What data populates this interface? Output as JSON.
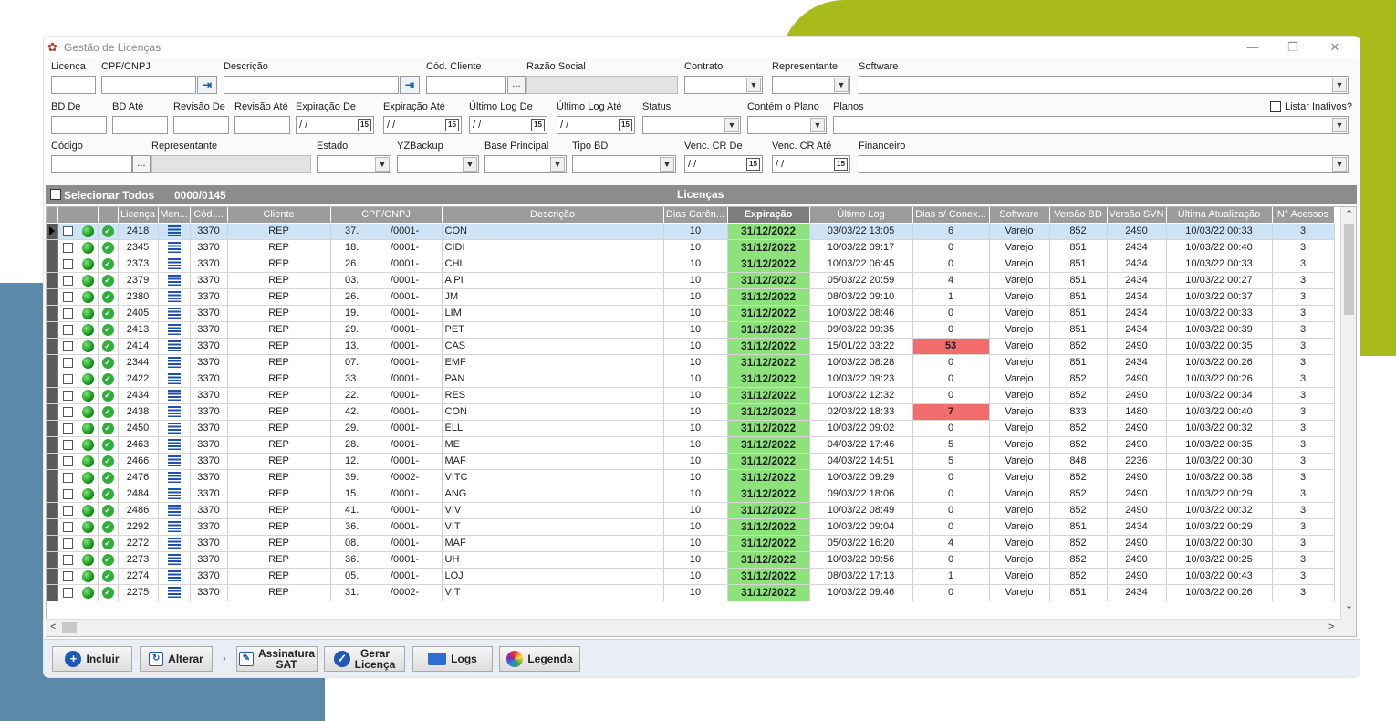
{
  "window": {
    "title": "Gestão de Licenças"
  },
  "filters": {
    "licenca": {
      "label": "Licença",
      "value": ""
    },
    "cpf_cnpj": {
      "label": "CPF/CNPJ",
      "value": ""
    },
    "descricao": {
      "label": "Descrição",
      "value": ""
    },
    "cod_cliente": {
      "label": "Cód. Cliente",
      "value": ""
    },
    "razao_social": {
      "label": "Razão Social",
      "value": ""
    },
    "contrato": {
      "label": "Contrato",
      "value": ""
    },
    "representante": {
      "label": "Representante",
      "value": ""
    },
    "software": {
      "label": "Software",
      "value": ""
    },
    "bd_de": {
      "label": "BD De",
      "value": ""
    },
    "bd_ate": {
      "label": "BD Até",
      "value": ""
    },
    "revisao_de": {
      "label": "Revisão De",
      "value": ""
    },
    "revisao_ate": {
      "label": "Revisão Até",
      "value": ""
    },
    "expiracao_de": {
      "label": "Expiração De",
      "value": " / /"
    },
    "expiracao_ate": {
      "label": "Expiração Até",
      "value": " / /"
    },
    "ultimo_log_de": {
      "label": "Último Log De",
      "value": " / /"
    },
    "ultimo_log_ate": {
      "label": "Último Log Até",
      "value": " / /"
    },
    "status": {
      "label": "Status",
      "value": ""
    },
    "contem_plano": {
      "label": "Contém o Plano",
      "value": ""
    },
    "planos": {
      "label": "Planos",
      "value": ""
    },
    "listar_inativos": {
      "label": "Listar Inativos?",
      "checked": false
    },
    "codigo": {
      "label": "Código",
      "value": ""
    },
    "representante2": {
      "label": "Representante",
      "value": ""
    },
    "estado": {
      "label": "Estado",
      "value": ""
    },
    "yzbackup": {
      "label": "YZBackup",
      "value": ""
    },
    "base_principal": {
      "label": "Base Principal",
      "value": ""
    },
    "tipo_bd": {
      "label": "Tipo BD",
      "value": ""
    },
    "venc_cr_de": {
      "label": "Venc. CR De",
      "value": " / /"
    },
    "venc_cr_ate": {
      "label": "Venc. CR Até",
      "value": " / /"
    },
    "financeiro": {
      "label": "Financeiro",
      "value": ""
    },
    "calendar_glyph": "15"
  },
  "grid": {
    "select_all_label": "Selecionar Todos",
    "counter": "0000/0145",
    "title": "Licenças",
    "columns": [
      "Licença",
      "Men...",
      "Cód....",
      "Cliente",
      "CPF/CNPJ",
      "Descrição",
      "Dias Carên...",
      "Expiração",
      "Último Log",
      "Dias s/ Conex...",
      "Software",
      "Versão BD",
      "Versão SVN",
      "Última Atualização",
      "N° Acessos"
    ],
    "rows": [
      {
        "lic": "2418",
        "cod": "3370",
        "cli": "REP",
        "cpf1": "37.",
        "cpf2": "/0001-",
        "desc": "CON",
        "dias": "10",
        "exp": "31/12/2022",
        "log": "03/03/22 13:05",
        "sem": "6",
        "sw": "Varejo",
        "bd": "852",
        "svn": "2490",
        "upd": "10/03/22 00:33",
        "acc": "3",
        "sel": true,
        "red": false
      },
      {
        "lic": "2345",
        "cod": "3370",
        "cli": "REP",
        "cpf1": "18.",
        "cpf2": "/0001-",
        "desc": "CIDI",
        "dias": "10",
        "exp": "31/12/2022",
        "log": "10/03/22 09:17",
        "sem": "0",
        "sw": "Varejo",
        "bd": "851",
        "svn": "2434",
        "upd": "10/03/22 00:40",
        "acc": "3",
        "sel": false,
        "red": false
      },
      {
        "lic": "2373",
        "cod": "3370",
        "cli": "REP",
        "cpf1": "26.",
        "cpf2": "/0001-",
        "desc": "CHI",
        "dias": "10",
        "exp": "31/12/2022",
        "log": "10/03/22 06:45",
        "sem": "0",
        "sw": "Varejo",
        "bd": "851",
        "svn": "2434",
        "upd": "10/03/22 00:33",
        "acc": "3",
        "sel": false,
        "red": false
      },
      {
        "lic": "2379",
        "cod": "3370",
        "cli": "REP",
        "cpf1": "03.",
        "cpf2": "/0001-",
        "desc": "A PI",
        "dias": "10",
        "exp": "31/12/2022",
        "log": "05/03/22 20:59",
        "sem": "4",
        "sw": "Varejo",
        "bd": "851",
        "svn": "2434",
        "upd": "10/03/22 00:27",
        "acc": "3",
        "sel": false,
        "red": false
      },
      {
        "lic": "2380",
        "cod": "3370",
        "cli": "REP",
        "cpf1": "26.",
        "cpf2": "/0001-",
        "desc": "JM",
        "dias": "10",
        "exp": "31/12/2022",
        "log": "08/03/22 09:10",
        "sem": "1",
        "sw": "Varejo",
        "bd": "851",
        "svn": "2434",
        "upd": "10/03/22 00:37",
        "acc": "3",
        "sel": false,
        "red": false
      },
      {
        "lic": "2405",
        "cod": "3370",
        "cli": "REP",
        "cpf1": "19.",
        "cpf2": "/0001-",
        "desc": "LIM",
        "dias": "10",
        "exp": "31/12/2022",
        "log": "10/03/22 08:46",
        "sem": "0",
        "sw": "Varejo",
        "bd": "851",
        "svn": "2434",
        "upd": "10/03/22 00:33",
        "acc": "3",
        "sel": false,
        "red": false
      },
      {
        "lic": "2413",
        "cod": "3370",
        "cli": "REP",
        "cpf1": "29.",
        "cpf2": "/0001-",
        "desc": "PET",
        "dias": "10",
        "exp": "31/12/2022",
        "log": "09/03/22 09:35",
        "sem": "0",
        "sw": "Varejo",
        "bd": "851",
        "svn": "2434",
        "upd": "10/03/22 00:39",
        "acc": "3",
        "sel": false,
        "red": false
      },
      {
        "lic": "2414",
        "cod": "3370",
        "cli": "REP",
        "cpf1": "13.",
        "cpf2": "/0001-",
        "desc": "CAS",
        "dias": "10",
        "exp": "31/12/2022",
        "log": "15/01/22 03:22",
        "sem": "53",
        "sw": "Varejo",
        "bd": "852",
        "svn": "2490",
        "upd": "10/03/22 00:35",
        "acc": "3",
        "sel": false,
        "red": true
      },
      {
        "lic": "2344",
        "cod": "3370",
        "cli": "REP",
        "cpf1": "07.",
        "cpf2": "/0001-",
        "desc": "EMF",
        "dias": "10",
        "exp": "31/12/2022",
        "log": "10/03/22 08:28",
        "sem": "0",
        "sw": "Varejo",
        "bd": "851",
        "svn": "2434",
        "upd": "10/03/22 00:26",
        "acc": "3",
        "sel": false,
        "red": false
      },
      {
        "lic": "2422",
        "cod": "3370",
        "cli": "REP",
        "cpf1": "33.",
        "cpf2": "/0001-",
        "desc": "PAN",
        "dias": "10",
        "exp": "31/12/2022",
        "log": "10/03/22 09:23",
        "sem": "0",
        "sw": "Varejo",
        "bd": "852",
        "svn": "2490",
        "upd": "10/03/22 00:26",
        "acc": "3",
        "sel": false,
        "red": false
      },
      {
        "lic": "2434",
        "cod": "3370",
        "cli": "REP",
        "cpf1": "22.",
        "cpf2": "/0001-",
        "desc": "RES",
        "dias": "10",
        "exp": "31/12/2022",
        "log": "10/03/22 12:32",
        "sem": "0",
        "sw": "Varejo",
        "bd": "852",
        "svn": "2490",
        "upd": "10/03/22 00:34",
        "acc": "3",
        "sel": false,
        "red": false
      },
      {
        "lic": "2438",
        "cod": "3370",
        "cli": "REP",
        "cpf1": "42.",
        "cpf2": "/0001-",
        "desc": "CON",
        "dias": "10",
        "exp": "31/12/2022",
        "log": "02/03/22 18:33",
        "sem": "7",
        "sw": "Varejo",
        "bd": "833",
        "svn": "1480",
        "upd": "10/03/22 00:40",
        "acc": "3",
        "sel": false,
        "red": true
      },
      {
        "lic": "2450",
        "cod": "3370",
        "cli": "REP",
        "cpf1": "29.",
        "cpf2": "/0001-",
        "desc": "ELL",
        "dias": "10",
        "exp": "31/12/2022",
        "log": "10/03/22 09:02",
        "sem": "0",
        "sw": "Varejo",
        "bd": "852",
        "svn": "2490",
        "upd": "10/03/22 00:32",
        "acc": "3",
        "sel": false,
        "red": false
      },
      {
        "lic": "2463",
        "cod": "3370",
        "cli": "REP",
        "cpf1": "28.",
        "cpf2": "/0001-",
        "desc": "ME",
        "dias": "10",
        "exp": "31/12/2022",
        "log": "04/03/22 17:46",
        "sem": "5",
        "sw": "Varejo",
        "bd": "852",
        "svn": "2490",
        "upd": "10/03/22 00:35",
        "acc": "3",
        "sel": false,
        "red": false
      },
      {
        "lic": "2466",
        "cod": "3370",
        "cli": "REP",
        "cpf1": "12.",
        "cpf2": "/0001-",
        "desc": "MAF",
        "dias": "10",
        "exp": "31/12/2022",
        "log": "04/03/22 14:51",
        "sem": "5",
        "sw": "Varejo",
        "bd": "848",
        "svn": "2236",
        "upd": "10/03/22 00:30",
        "acc": "3",
        "sel": false,
        "red": false
      },
      {
        "lic": "2476",
        "cod": "3370",
        "cli": "REP",
        "cpf1": "39.",
        "cpf2": "/0002-",
        "desc": "VITC",
        "dias": "10",
        "exp": "31/12/2022",
        "log": "10/03/22 09:29",
        "sem": "0",
        "sw": "Varejo",
        "bd": "852",
        "svn": "2490",
        "upd": "10/03/22 00:38",
        "acc": "3",
        "sel": false,
        "red": false
      },
      {
        "lic": "2484",
        "cod": "3370",
        "cli": "REP",
        "cpf1": "15.",
        "cpf2": "/0001-",
        "desc": "ANG",
        "dias": "10",
        "exp": "31/12/2022",
        "log": "09/03/22 18:06",
        "sem": "0",
        "sw": "Varejo",
        "bd": "852",
        "svn": "2490",
        "upd": "10/03/22 00:29",
        "acc": "3",
        "sel": false,
        "red": false
      },
      {
        "lic": "2486",
        "cod": "3370",
        "cli": "REP",
        "cpf1": "41.",
        "cpf2": "/0001-",
        "desc": "VIV",
        "dias": "10",
        "exp": "31/12/2022",
        "log": "10/03/22 08:49",
        "sem": "0",
        "sw": "Varejo",
        "bd": "852",
        "svn": "2490",
        "upd": "10/03/22 00:32",
        "acc": "3",
        "sel": false,
        "red": false
      },
      {
        "lic": "2292",
        "cod": "3370",
        "cli": "REP",
        "cpf1": "36.",
        "cpf2": "/0001-",
        "desc": "VIT",
        "dias": "10",
        "exp": "31/12/2022",
        "log": "10/03/22 09:04",
        "sem": "0",
        "sw": "Varejo",
        "bd": "851",
        "svn": "2434",
        "upd": "10/03/22 00:29",
        "acc": "3",
        "sel": false,
        "red": false
      },
      {
        "lic": "2272",
        "cod": "3370",
        "cli": "REP",
        "cpf1": "08.",
        "cpf2": "/0001-",
        "desc": "MAF",
        "dias": "10",
        "exp": "31/12/2022",
        "log": "05/03/22 16:20",
        "sem": "4",
        "sw": "Varejo",
        "bd": "852",
        "svn": "2490",
        "upd": "10/03/22 00:30",
        "acc": "3",
        "sel": false,
        "red": false
      },
      {
        "lic": "2273",
        "cod": "3370",
        "cli": "REP",
        "cpf1": "36.",
        "cpf2": "/0001-",
        "desc": "UH",
        "dias": "10",
        "exp": "31/12/2022",
        "log": "10/03/22 09:56",
        "sem": "0",
        "sw": "Varejo",
        "bd": "852",
        "svn": "2490",
        "upd": "10/03/22 00:25",
        "acc": "3",
        "sel": false,
        "red": false
      },
      {
        "lic": "2274",
        "cod": "3370",
        "cli": "REP",
        "cpf1": "05.",
        "cpf2": "/0001-",
        "desc": "LOJ",
        "dias": "10",
        "exp": "31/12/2022",
        "log": "08/03/22 17:13",
        "sem": "1",
        "sw": "Varejo",
        "bd": "852",
        "svn": "2490",
        "upd": "10/03/22 00:43",
        "acc": "3",
        "sel": false,
        "red": false
      },
      {
        "lic": "2275",
        "cod": "3370",
        "cli": "REP",
        "cpf1": "31.",
        "cpf2": "/0002-",
        "desc": "VIT",
        "dias": "10",
        "exp": "31/12/2022",
        "log": "10/03/22 09:46",
        "sem": "0",
        "sw": "Varejo",
        "bd": "851",
        "svn": "2434",
        "upd": "10/03/22 00:26",
        "acc": "3",
        "sel": false,
        "red": false
      }
    ]
  },
  "footer": {
    "incluir": "Incluir",
    "alterar": "Alterar",
    "assinatura_sat_1": "Assinatura",
    "assinatura_sat_2": "SAT",
    "gerar_licenca_1": "Gerar",
    "gerar_licenca_2": "Licença",
    "logs": "Logs",
    "legenda": "Legenda"
  },
  "colors": {
    "accent_green": "#a9bb1a",
    "accent_blue": "#5b8aa8",
    "expiry_cell": "#8ee27c",
    "alert_cell": "#f26d6d",
    "selected_row": "#cde4f7"
  }
}
